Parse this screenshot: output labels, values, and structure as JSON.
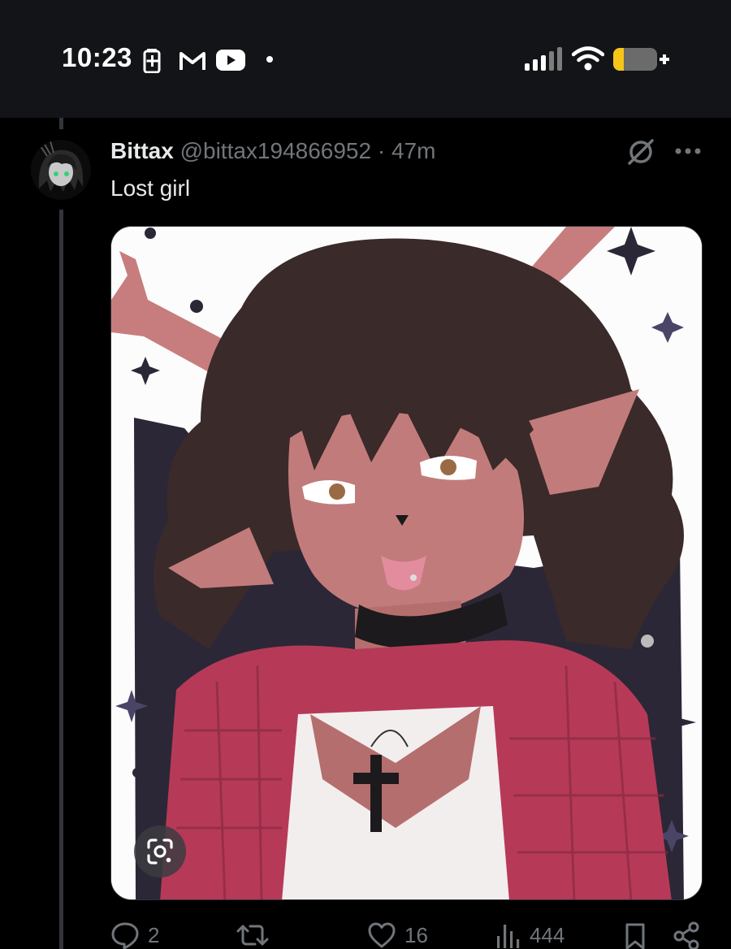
{
  "status_bar": {
    "time": "10:23",
    "left_icons": [
      "battery-saver-icon",
      "gmail-icon",
      "youtube-icon",
      "dot-icon"
    ],
    "right_icons": [
      "signal-icon",
      "wifi-icon",
      "battery-icon"
    ],
    "battery_color": "#f5c518"
  },
  "tweet": {
    "author_name": "Bittax",
    "author_handle": "@bittax194866952",
    "separator": "·",
    "timestamp": "47m",
    "text": "Lost girl",
    "header_icons": [
      "grok-icon",
      "more-icon"
    ],
    "media_icons": [
      "google-lens-icon"
    ],
    "actions": {
      "replies": "2",
      "retweets": "",
      "likes": "16",
      "views": "444"
    }
  },
  "colors": {
    "background": "#000000",
    "status_bar_bg": "#121417",
    "primary_text": "#e7e9ea",
    "secondary_text": "#71767b",
    "thread_line": "#333639"
  }
}
